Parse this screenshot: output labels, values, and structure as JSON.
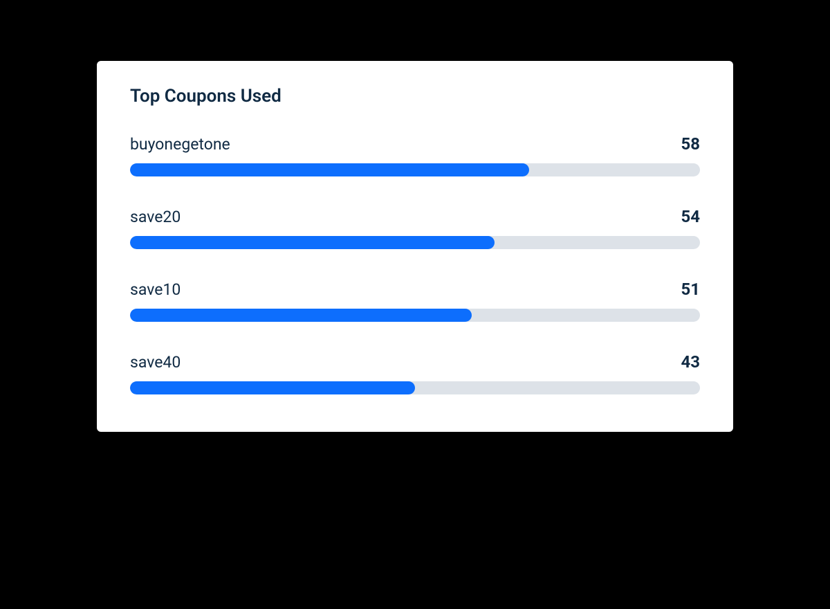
{
  "title": "Top Coupons Used",
  "colors": {
    "bar_fill": "#0d6efd",
    "bar_track": "#dde2e8",
    "text": "#102a43"
  },
  "chart_data": {
    "type": "bar",
    "title": "Top Coupons Used",
    "orientation": "horizontal",
    "categories": [
      "buyonegetone",
      "save20",
      "save10",
      "save40"
    ],
    "values": [
      58,
      54,
      51,
      43
    ],
    "percent_fill": [
      70,
      64,
      60,
      50
    ],
    "xlabel": "",
    "ylabel": "",
    "ylim": [
      0,
      100
    ]
  }
}
